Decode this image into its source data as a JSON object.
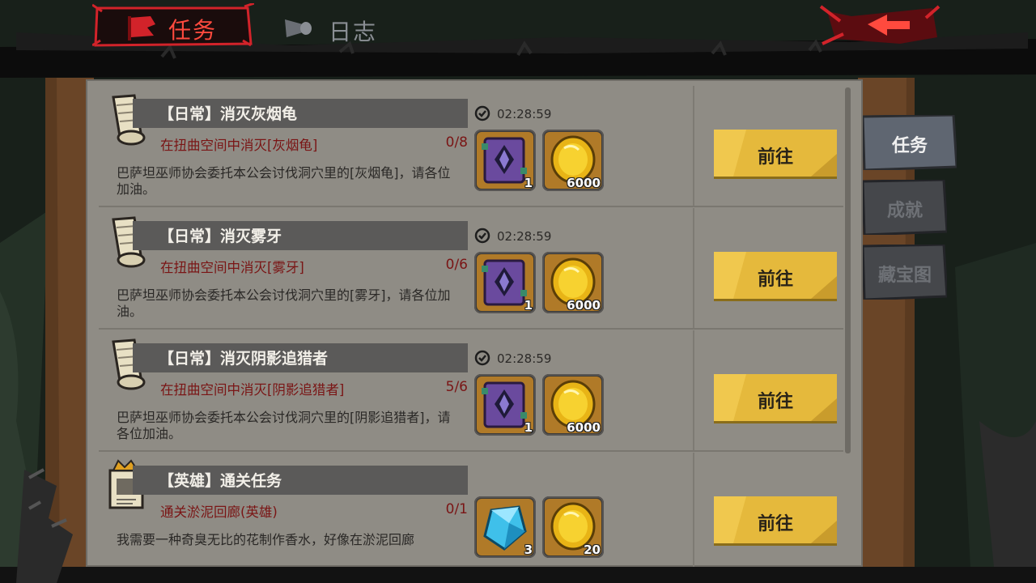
{
  "tabs": [
    {
      "label": "任务",
      "active": true
    },
    {
      "label": "日志",
      "active": false
    }
  ],
  "side_tabs": [
    {
      "label": "任务",
      "active": true
    },
    {
      "label": "成就",
      "active": false
    },
    {
      "label": "藏宝图",
      "active": false
    }
  ],
  "quests": [
    {
      "title": "【日常】消灭灰烟龟",
      "objective": "在扭曲空间中消灭[灰烟龟]",
      "progress": "0/8",
      "description": "巴萨坦巫师协会委托本公会讨伐洞穴里的[灰烟龟]，请各位加油。",
      "timer": "02:28:59",
      "icon": "scroll-icon",
      "rewards": [
        {
          "icon": "purple-tome-icon",
          "count": "1"
        },
        {
          "icon": "gold-coin-icon",
          "count": "6000"
        }
      ],
      "button": "前往"
    },
    {
      "title": "【日常】消灭雾牙",
      "objective": "在扭曲空间中消灭[雾牙]",
      "progress": "0/6",
      "description": "巴萨坦巫师协会委托本公会讨伐洞穴里的[雾牙]，请各位加油。",
      "timer": "02:28:59",
      "icon": "scroll-icon",
      "rewards": [
        {
          "icon": "purple-tome-icon",
          "count": "1"
        },
        {
          "icon": "gold-coin-icon",
          "count": "6000"
        }
      ],
      "button": "前往"
    },
    {
      "title": "【日常】消灭阴影追猎者",
      "objective": "在扭曲空间中消灭[阴影追猎者]",
      "progress": "5/6",
      "description": "巴萨坦巫师协会委托本公会讨伐洞穴里的[阴影追猎者]，请各位加油。",
      "timer": "02:28:59",
      "icon": "scroll-icon",
      "rewards": [
        {
          "icon": "purple-tome-icon",
          "count": "1"
        },
        {
          "icon": "gold-coin-icon",
          "count": "6000"
        }
      ],
      "button": "前往"
    },
    {
      "title": "【英雄】通关任务",
      "objective": "通关淤泥回廊(英雄)",
      "progress": "0/1",
      "description": "我需要一种奇臭无比的花制作香水，好像在淤泥回廊",
      "timer": "",
      "icon": "hero-notice-icon",
      "rewards": [
        {
          "icon": "blue-crystal-icon",
          "count": "3"
        },
        {
          "icon": "gold-coin-icon",
          "count": "20"
        }
      ],
      "button": "前往"
    }
  ],
  "colors": {
    "panel": "#8f8c85",
    "title_bar": "#5b5a59",
    "objective_text": "#7a1515",
    "button": "#e5b93c",
    "active_tab": "#ff4a3e",
    "side_tab_active": "#5f6671",
    "side_tab_inactive": "#45474b"
  }
}
